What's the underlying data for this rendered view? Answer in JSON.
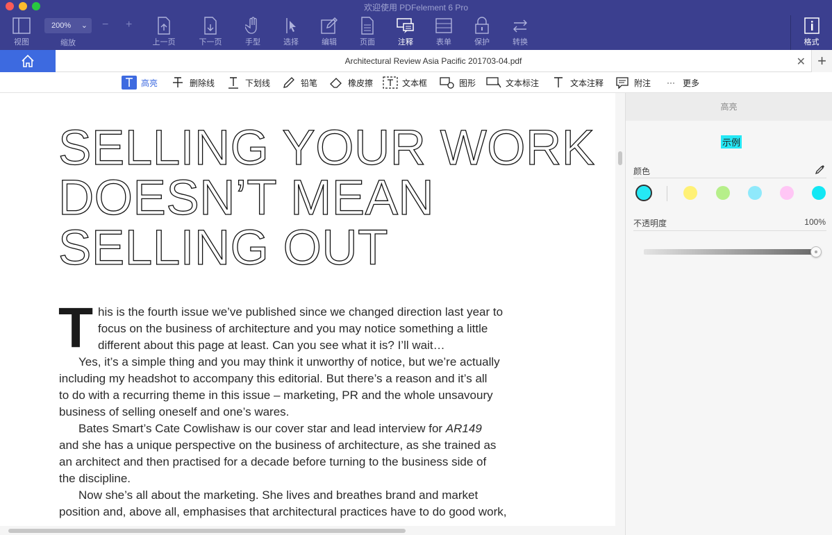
{
  "window": {
    "title": "欢迎使用 PDFelement 6 Pro"
  },
  "toolbar": {
    "view_label": "视图",
    "zoom_value": "200%",
    "zoom_label": "缩放",
    "zoom_minus": "−",
    "zoom_plus": "+",
    "prev_page": "上一页",
    "next_page": "下一页",
    "hand": "手型",
    "select": "选择",
    "edit": "编辑",
    "page": "页面",
    "comment": "注释",
    "form": "表单",
    "protect": "保护",
    "convert": "转换",
    "format": "格式"
  },
  "tabs": {
    "document_tab": "Architectural Review Asia Pacific 201703-04.pdf"
  },
  "annotation_tools": [
    {
      "label": "高亮",
      "icon": "text-highlight-icon"
    },
    {
      "label": "删除线",
      "icon": "strikethrough-icon"
    },
    {
      "label": "下划线",
      "icon": "underline-icon"
    },
    {
      "label": "铅笔",
      "icon": "pencil-icon"
    },
    {
      "label": "橡皮擦",
      "icon": "eraser-icon"
    },
    {
      "label": "文本框",
      "icon": "textbox-icon"
    },
    {
      "label": "图形",
      "icon": "shape-icon"
    },
    {
      "label": "文本标注",
      "icon": "callout-icon"
    },
    {
      "label": "文本注释",
      "icon": "typewriter-icon"
    },
    {
      "label": "附注",
      "icon": "note-icon"
    },
    {
      "label": "更多",
      "icon": "more-icon"
    }
  ],
  "document": {
    "title_lines": [
      "SELLING YOUR WORK",
      "DOESN’T MEAN",
      "SELLING OUT"
    ],
    "drop_cap": "T",
    "lines": [
      "his is the fourth issue we’ve published since we changed direction last year to",
      "focus on the business of architecture and you may notice something a little",
      "different about this page at least. Can you see what it is? I’ll wait…",
      "Yes, it’s a simple thing and you may think it unworthy of notice, but we’re actually",
      "including my headshot to accompany this editorial. But there’s a reason and it’s all",
      "to do with a recurring theme in this issue – marketing, PR and the whole unsavoury",
      "business of selling oneself and one’s wares.",
      "Bates Smart’s Cate Cowlishaw is our cover star and lead interview for ",
      "and she has a unique perspective on the business of architecture, as she trained as",
      "an architect and then practised for a decade before turning to the business side of",
      "the discipline.",
      "Now she’s all about the marketing. She lives and breathes brand and market",
      "position and, above all, emphasises that architectural practices have to do good work,"
    ],
    "italic_ref": "AR149"
  },
  "panel": {
    "header": "高亮",
    "sample_text": "示例",
    "color_label": "颜色",
    "swatches": [
      "#25e8f5",
      "#fff176",
      "#b6ef8a",
      "#8fe9fb",
      "#ffc6f5",
      "#13e7f4"
    ],
    "selected_swatch": "#25e8f5",
    "opacity_label": "不透明度",
    "opacity_value": "100%",
    "opacity_level": 1.0
  },
  "colors": {
    "toolbar_bg": "#3b3f8f",
    "accent": "#3d6ae0"
  }
}
